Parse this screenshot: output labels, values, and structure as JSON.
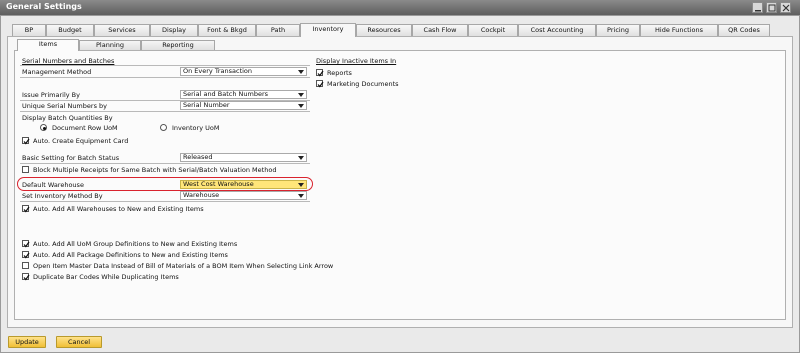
{
  "window": {
    "title": "General Settings"
  },
  "tabs": [
    "BP",
    "Budget",
    "Services",
    "Display",
    "Font & Bkgd",
    "Path",
    "Inventory",
    "Resources",
    "Cash Flow",
    "Cockpit",
    "Cost Accounting",
    "Pricing",
    "Hide Functions",
    "QR Codes"
  ],
  "subtabs": [
    "Items",
    "Planning",
    "Reporting"
  ],
  "serial": {
    "heading": "Serial Numbers and Batches",
    "management_label": "Management Method",
    "management_value": "On Every Transaction",
    "issue_label": "Issue Primarily By",
    "issue_value": "Serial and Batch Numbers",
    "unique_label": "Unique Serial Numbers by",
    "unique_value": "Serial Number",
    "display_batch_label": "Display Batch Quantities By",
    "radio_doc_row": "Document Row UoM",
    "radio_inventory": "Inventory UoM",
    "auto_equipment": "Auto. Create Equipment Card",
    "basic_batch_label": "Basic Setting for Batch Status",
    "basic_batch_value": "Released",
    "block_receipts": "Block Multiple Receipts for Same Batch with Serial/Batch Valuation Method"
  },
  "warehouse": {
    "default_label": "Default Warehouse",
    "default_value": "West Cost Warehouse",
    "inventory_method_label": "Set Inventory Method By",
    "inventory_method_value": "Warehouse",
    "auto_add_warehouses": "Auto. Add All Warehouses to New and Existing Items"
  },
  "options": {
    "uom_groups": "Auto. Add All UoM Group Definitions to New and Existing Items",
    "package_defs": "Auto. Add All Package Definitions to New and Existing Items",
    "open_master": "Open Item Master Data Instead of Bill of Materials of a BOM Item When Selecting Link Arrow",
    "duplicate_barcodes": "Duplicate Bar Codes While Duplicating Items"
  },
  "inactive": {
    "heading": "Display Inactive Items In",
    "reports": "Reports",
    "marketing": "Marketing Documents"
  },
  "buttons": {
    "update": "Update",
    "cancel": "Cancel"
  },
  "state": {
    "active_tab": "Inventory",
    "active_subtab": "Items",
    "radio_selected": "Document Row UoM",
    "checked": [
      "auto_equipment",
      "auto_add_warehouses",
      "uom_groups",
      "package_defs",
      "duplicate_barcodes",
      "reports",
      "marketing"
    ],
    "unchecked": [
      "block_receipts",
      "open_master"
    ],
    "highlight_color": "#d9232e",
    "field_highlight_color": "#ffe67a"
  }
}
